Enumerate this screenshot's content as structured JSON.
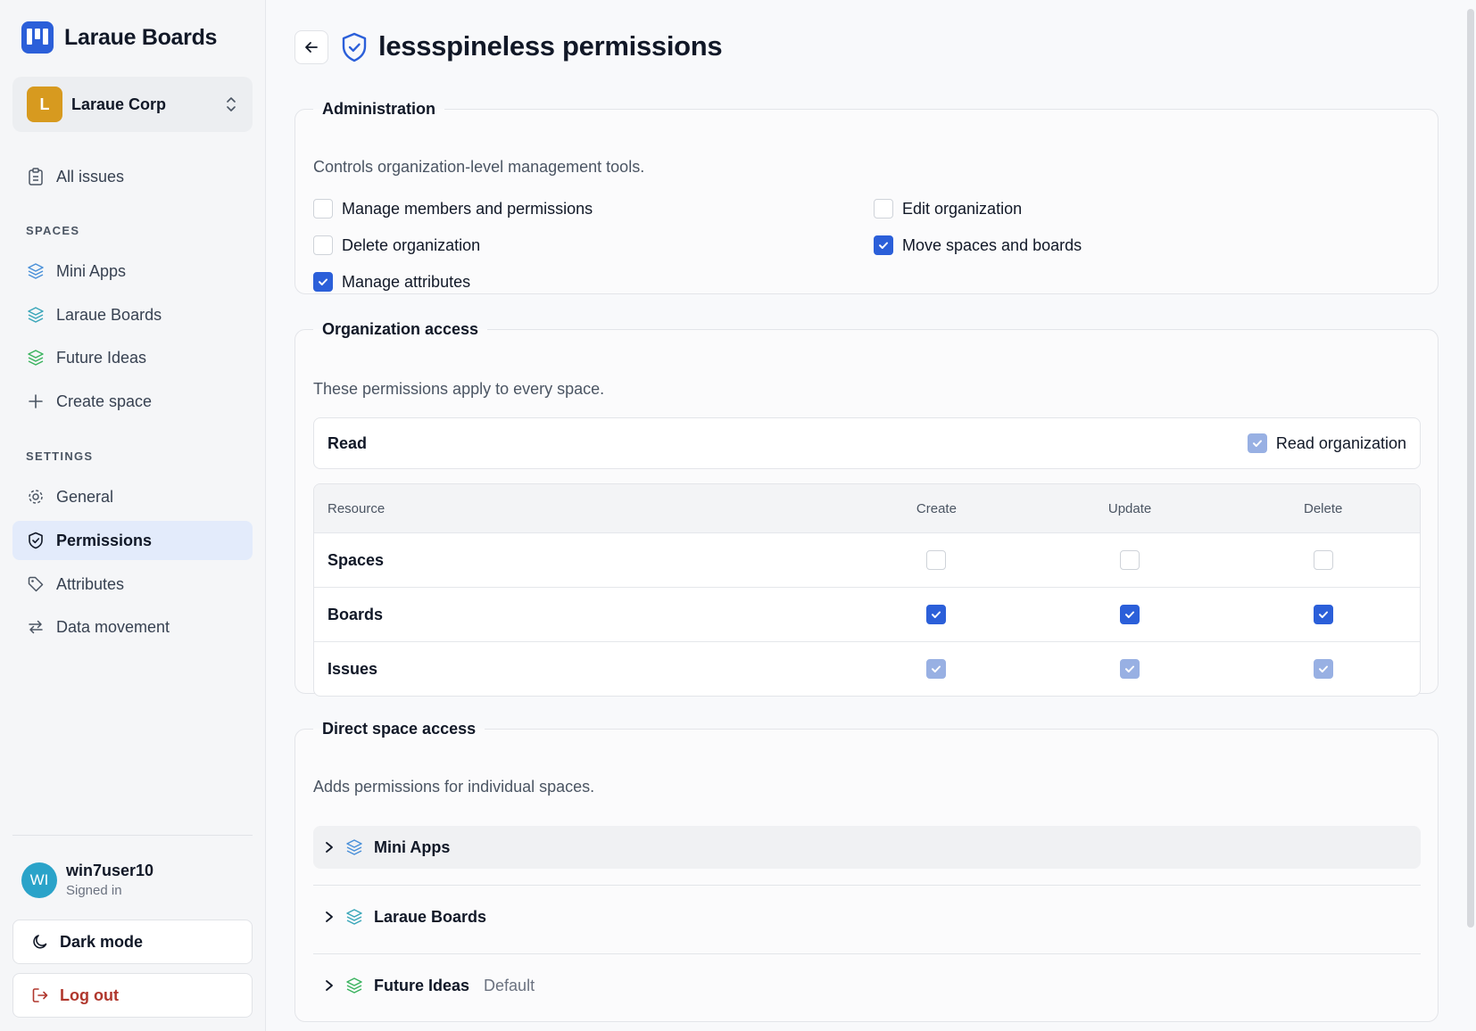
{
  "app": {
    "name": "Laraue Boards"
  },
  "org": {
    "initial": "L",
    "name": "Laraue Corp"
  },
  "nav": {
    "all_issues": "All issues",
    "spaces_heading": "SPACES",
    "spaces": [
      {
        "label": "Mini Apps",
        "color": "#4a90d9"
      },
      {
        "label": "Laraue Boards",
        "color": "#3aa6b9"
      },
      {
        "label": "Future Ideas",
        "color": "#3bb35f"
      }
    ],
    "create_space": "Create space",
    "settings_heading": "SETTINGS",
    "settings": [
      {
        "label": "General",
        "icon": "gear-icon"
      },
      {
        "label": "Permissions",
        "icon": "shield-icon",
        "active": true
      },
      {
        "label": "Attributes",
        "icon": "tag-icon"
      },
      {
        "label": "Data movement",
        "icon": "arrows-icon"
      }
    ]
  },
  "user": {
    "initials": "WI",
    "name": "win7user10",
    "status": "Signed in"
  },
  "buttons": {
    "dark_mode": "Dark mode",
    "log_out": "Log out"
  },
  "page": {
    "title": "lessspineless permissions"
  },
  "administration": {
    "legend": "Administration",
    "description": "Controls organization-level management tools.",
    "permissions": [
      {
        "label": "Manage members and permissions",
        "checked": false
      },
      {
        "label": "Edit organization",
        "checked": false
      },
      {
        "label": "Delete organization",
        "checked": false
      },
      {
        "label": "Move spaces and boards",
        "checked": true
      },
      {
        "label": "Manage attributes",
        "checked": true
      }
    ]
  },
  "org_access": {
    "legend": "Organization access",
    "description": "These permissions apply to every space.",
    "read_label": "Read",
    "read_org_label": "Read organization",
    "read_org_state": "implied",
    "table": {
      "headers": [
        "Resource",
        "Create",
        "Update",
        "Delete"
      ],
      "rows": [
        {
          "resource": "Spaces",
          "create": "off",
          "update": "off",
          "delete": "off"
        },
        {
          "resource": "Boards",
          "create": "on",
          "update": "on",
          "delete": "on"
        },
        {
          "resource": "Issues",
          "create": "implied",
          "update": "implied",
          "delete": "implied"
        }
      ]
    }
  },
  "direct_access": {
    "legend": "Direct space access",
    "description": "Adds permissions for individual spaces.",
    "spaces": [
      {
        "name": "Mini Apps",
        "tag": ""
      },
      {
        "name": "Laraue Boards",
        "tag": ""
      },
      {
        "name": "Future Ideas",
        "tag": "Default"
      }
    ]
  }
}
